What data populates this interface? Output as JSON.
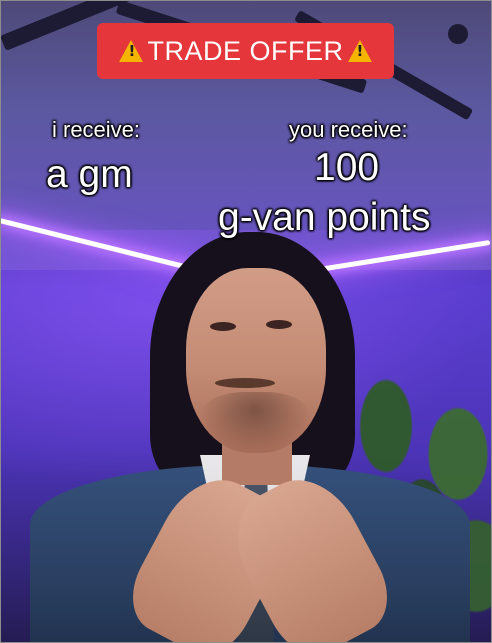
{
  "banner": {
    "text": "TRADE OFFER",
    "icon_left": "warning-icon",
    "icon_right": "warning-icon",
    "color": "#e5363b",
    "icon_color": "#f5b400"
  },
  "left": {
    "heading": "i receive:",
    "item": "a gm"
  },
  "right": {
    "heading": "you receive:",
    "item_line1": "100",
    "item_line2": "g-van points"
  },
  "scene": {
    "accent_neon": "#b873ff",
    "wall": "#5b3ed0"
  }
}
